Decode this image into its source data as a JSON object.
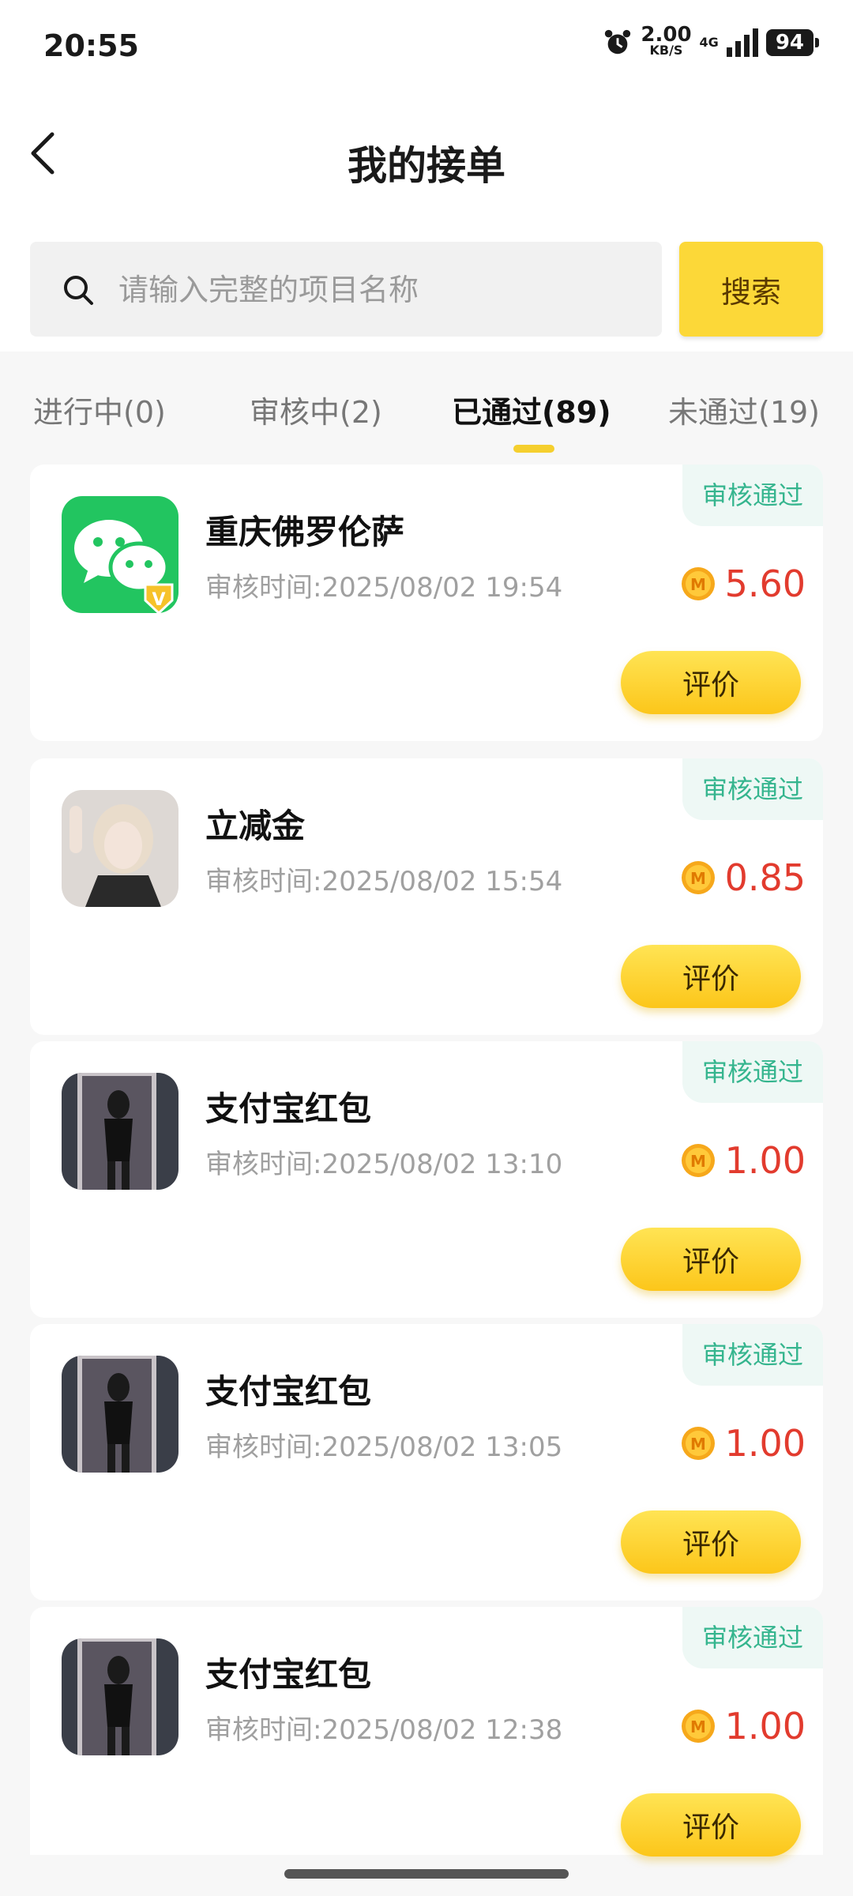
{
  "status_bar": {
    "time": "20:55",
    "speed_value": "2.00",
    "speed_unit": "KB/S",
    "network": "4G",
    "battery": "94",
    "icons": [
      "alarm-icon",
      "signal-icon",
      "battery-icon"
    ]
  },
  "header": {
    "title": "我的接单",
    "back_icon": "chevron-left-icon"
  },
  "search": {
    "placeholder": "请输入完整的项目名称",
    "value": "",
    "button_label": "搜索"
  },
  "tabs": [
    {
      "label": "进行中(0)",
      "active": false
    },
    {
      "label": "审核中(2)",
      "active": false
    },
    {
      "label": "已通过(89)",
      "active": true
    },
    {
      "label": "未通过(19)",
      "active": false
    }
  ],
  "orders": [
    {
      "title": "重庆佛罗伦萨",
      "time": "审核时间:2025/08/02 19:54",
      "status": "审核通过",
      "amount": "5.60",
      "button": "评价",
      "avatar": "wechat-logo"
    },
    {
      "title": "立减金",
      "time": "审核时间:2025/08/02 15:54",
      "status": "审核通过",
      "amount": "0.85",
      "button": "评价",
      "avatar": "user-photo"
    },
    {
      "title": "支付宝红包",
      "time": "审核时间:2025/08/02 13:10",
      "status": "审核通过",
      "amount": "1.00",
      "button": "评价",
      "avatar": "user-photo"
    },
    {
      "title": "支付宝红包",
      "time": "审核时间:2025/08/02 13:05",
      "status": "审核通过",
      "amount": "1.00",
      "button": "评价",
      "avatar": "user-photo"
    },
    {
      "title": "支付宝红包",
      "time": "审核时间:2025/08/02 12:38",
      "status": "审核通过",
      "amount": "1.00",
      "button": "评价",
      "avatar": "user-photo"
    }
  ],
  "colors": {
    "accent": "#fcd838",
    "status_green": "#35b58e",
    "amount_red": "#e23b2e"
  }
}
